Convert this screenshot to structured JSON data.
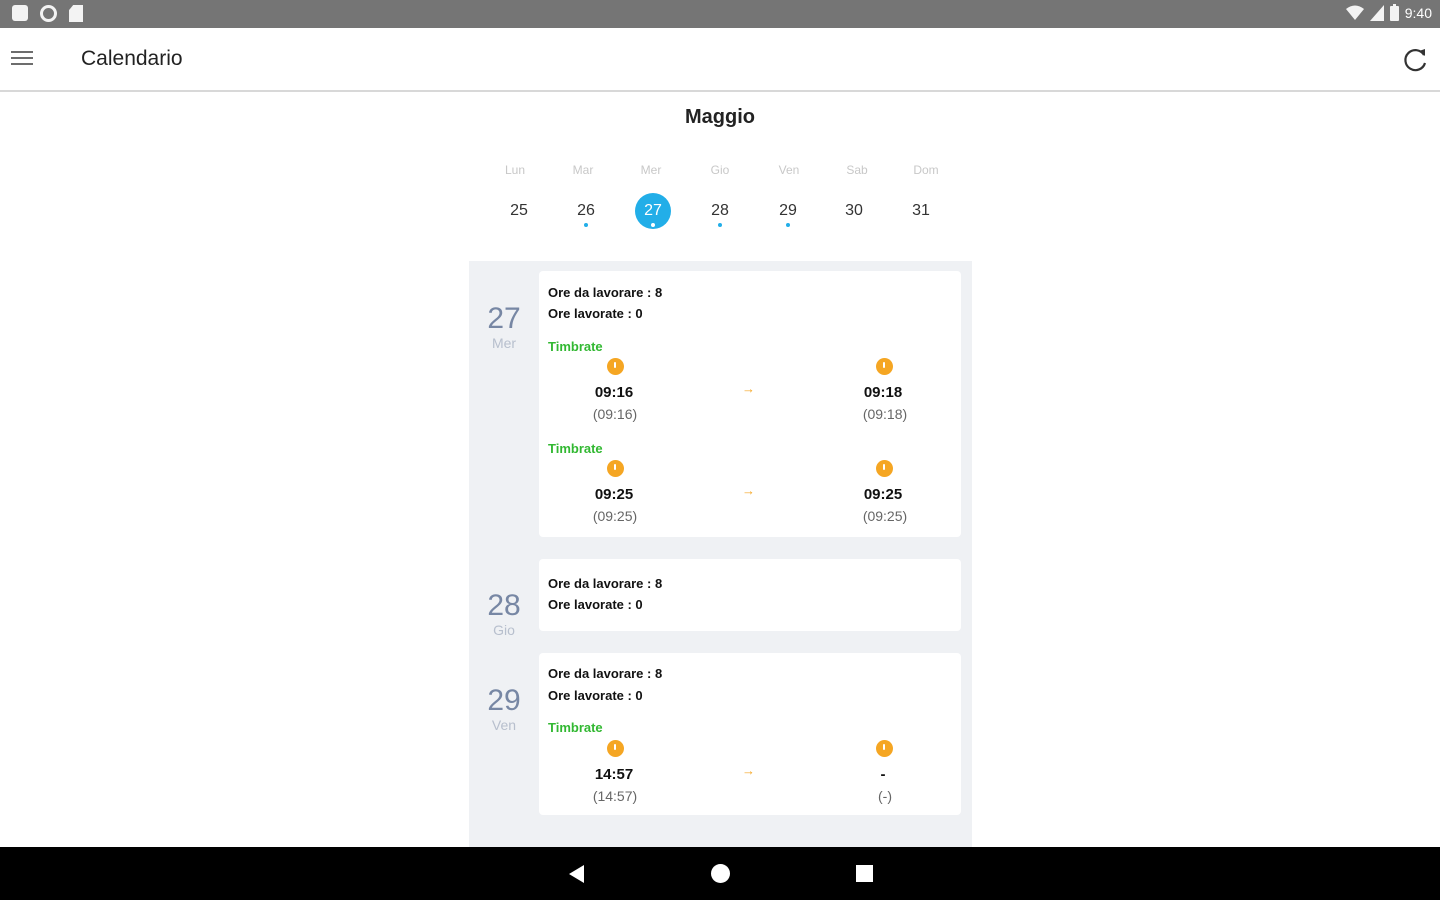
{
  "status_bar": {
    "time": "9:40"
  },
  "app_bar": {
    "title": "Calendario"
  },
  "calendar": {
    "month": "Maggio",
    "weekdays": [
      "Lun",
      "Mar",
      "Mer",
      "Gio",
      "Ven",
      "Sab",
      "Dom"
    ],
    "dates": [
      "25",
      "26",
      "27",
      "28",
      "29",
      "30",
      "31"
    ],
    "selected_date": "27",
    "dates_with_events": [
      "26",
      "27",
      "28",
      "29"
    ]
  },
  "days": [
    {
      "day": "27",
      "weekday": "Mer",
      "hours_to_work": "Ore da lavorare : 8",
      "hours_worked": "Ore lavorate : 0",
      "stamps": [
        {
          "label": "Timbrate",
          "in": "09:16",
          "in_sub": "(09:16)",
          "out": "09:18",
          "out_sub": "(09:18)"
        },
        {
          "label": "Timbrate",
          "in": "09:25",
          "in_sub": "(09:25)",
          "out": "09:25",
          "out_sub": "(09:25)"
        }
      ]
    },
    {
      "day": "28",
      "weekday": "Gio",
      "hours_to_work": "Ore da lavorare : 8",
      "hours_worked": "Ore lavorate : 0",
      "stamps": []
    },
    {
      "day": "29",
      "weekday": "Ven",
      "hours_to_work": "Ore da lavorare : 8",
      "hours_worked": "Ore lavorate : 0",
      "stamps": [
        {
          "label": "Timbrate",
          "in": "14:57",
          "in_sub": "(14:57)",
          "out": "-",
          "out_sub": "(-)"
        }
      ]
    }
  ],
  "colors": {
    "accent": "#22aee8",
    "stamp_label": "#32b832",
    "clock": "#f5a623"
  }
}
